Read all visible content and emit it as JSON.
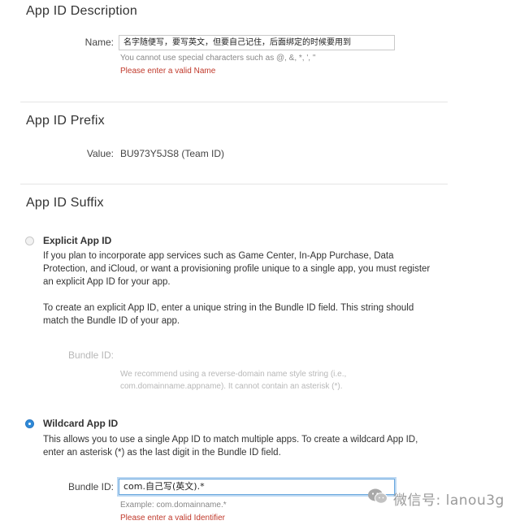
{
  "sections": {
    "description": {
      "title": "App ID Description",
      "name_label": "Name:",
      "name_value": "名字随便写，要写英文，但要自己记住，后面绑定的时候要用到",
      "name_hint": "You cannot use special characters such as @, &, *, ', \"",
      "name_error": "Please enter a valid Name"
    },
    "prefix": {
      "title": "App ID Prefix",
      "value_label": "Value:",
      "value": "BU973Y5JS8 (Team ID)"
    },
    "suffix": {
      "title": "App ID Suffix",
      "explicit": {
        "label": "Explicit App ID",
        "selected": false,
        "description": "If you plan to incorporate app services such as Game Center, In-App Purchase, Data Protection, and iCloud, or want a provisioning profile unique to a single app, you must register an explicit App ID for your app.",
        "instructions": "To create an explicit App ID, enter a unique string in the Bundle ID field. This string should match the Bundle ID of your app.",
        "bundle_label": "Bundle ID:",
        "bundle_hint": "We recommend using a reverse-domain name style string (i.e., com.domainname.appname). It cannot contain an asterisk (*)."
      },
      "wildcard": {
        "label": "Wildcard App ID",
        "selected": true,
        "description": "This allows you to use a single App ID to match multiple apps. To create a wildcard App ID, enter an asterisk (*) as the last digit in the Bundle ID field.",
        "bundle_label": "Bundle ID:",
        "bundle_value": "com.自己写(英文).*",
        "bundle_example": "Example: com.domainname.*",
        "bundle_error": "Please enter a valid Identifier"
      }
    }
  },
  "watermark": {
    "text": "微信号: lanou3g",
    "icon": "wechat-icon"
  },
  "colors": {
    "error": "#c0392b",
    "radio_selected": "#2f8ad8",
    "focus_ring": "#6aa8de"
  }
}
